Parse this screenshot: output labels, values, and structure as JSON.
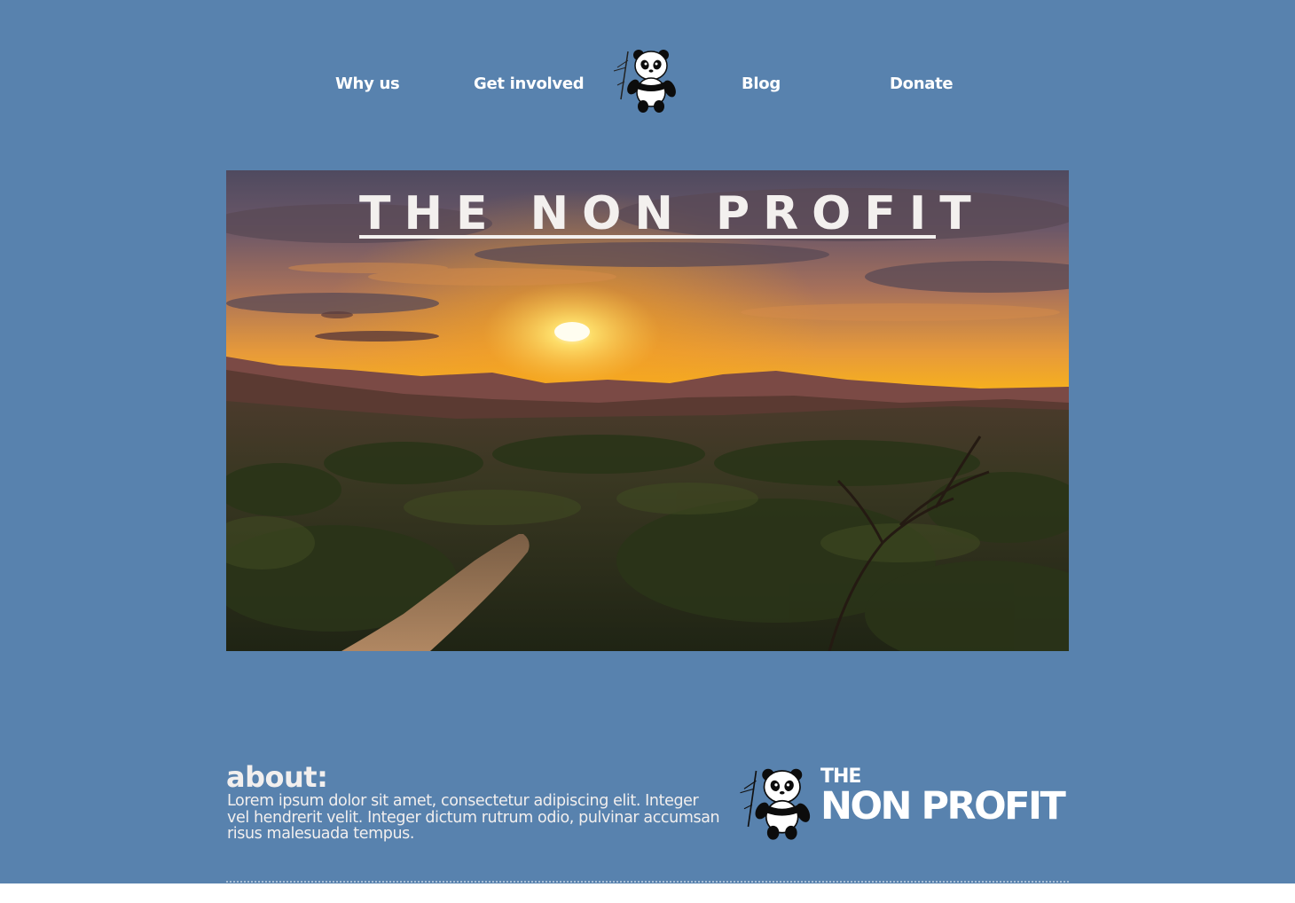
{
  "colors": {
    "background": "#5882ae",
    "text": "#ffffff",
    "panda_black": "#0c0c0c"
  },
  "nav": {
    "items": [
      {
        "label": "Why us"
      },
      {
        "label": "Get involved"
      },
      {
        "label": "Blog"
      },
      {
        "label": "Donate"
      }
    ],
    "logo_icon": "panda-bamboo-icon"
  },
  "hero": {
    "title": "THE NON PROFIT",
    "image": "savanna-sunset-photo"
  },
  "about": {
    "heading": "about:",
    "body": "Lorem ipsum dolor sit amet, consectetur adipiscing elit. Integer vel hendrerit velit. Integer dictum rutrum odio, pulvinar accumsan risus malesuada tempus."
  },
  "footer": {
    "brand_small": "THE",
    "brand_large": "NON PROFIT",
    "logo_icon": "panda-bamboo-icon"
  }
}
